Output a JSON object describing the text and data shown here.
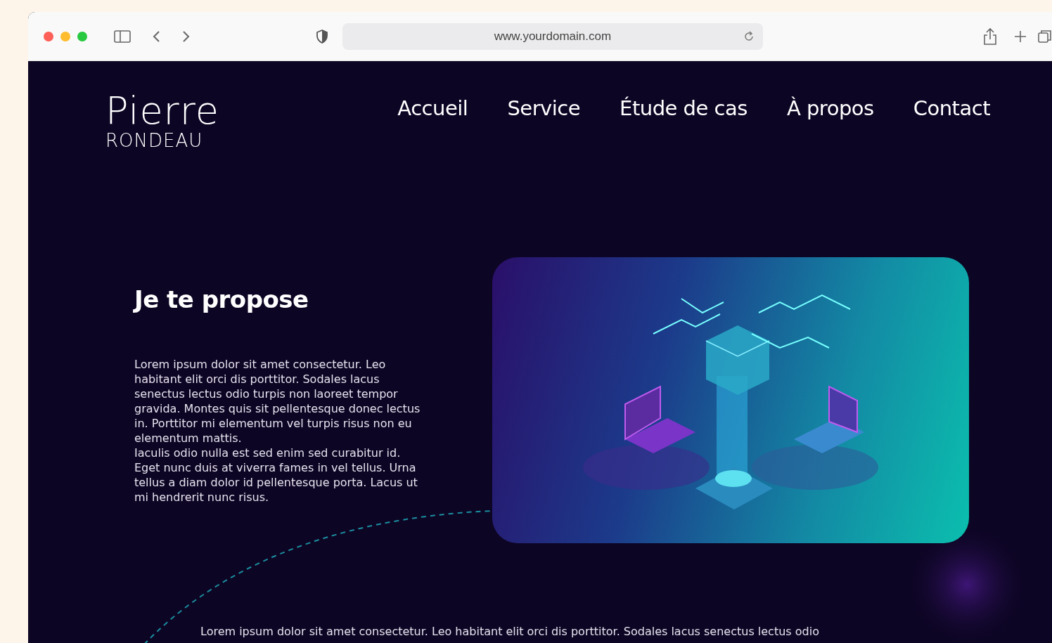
{
  "browser": {
    "url": "www.yourdomain.com"
  },
  "logo": {
    "first_name": "Pierre",
    "last_name": "RONDEAU"
  },
  "nav": [
    {
      "label": "Accueil"
    },
    {
      "label": "Service"
    },
    {
      "label": "Étude de cas"
    },
    {
      "label": "À propos"
    },
    {
      "label": "Contact"
    }
  ],
  "hero": {
    "heading": "Je te propose",
    "paragraphs": [
      "Lorem ipsum dolor sit amet consectetur. Leo habitant elit orci dis porttitor. Sodales lacus senectus lectus odio turpis non laoreet tempor gravida. Montes quis sit pellentesque donec lectus in. Porttitor mi elementum vel turpis risus non eu elementum mattis.",
      "Iaculis odio nulla est sed enim sed curabitur id.",
      "Eget nunc duis at viverra fames in vel tellus. Urna tellus a diam dolor id pellentesque porta. Lacus ut mi hendrerit nunc risus."
    ]
  },
  "footer_text": "Lorem ipsum dolor sit amet consectetur. Leo habitant elit orci dis porttitor. Sodales lacus senectus lectus odio"
}
